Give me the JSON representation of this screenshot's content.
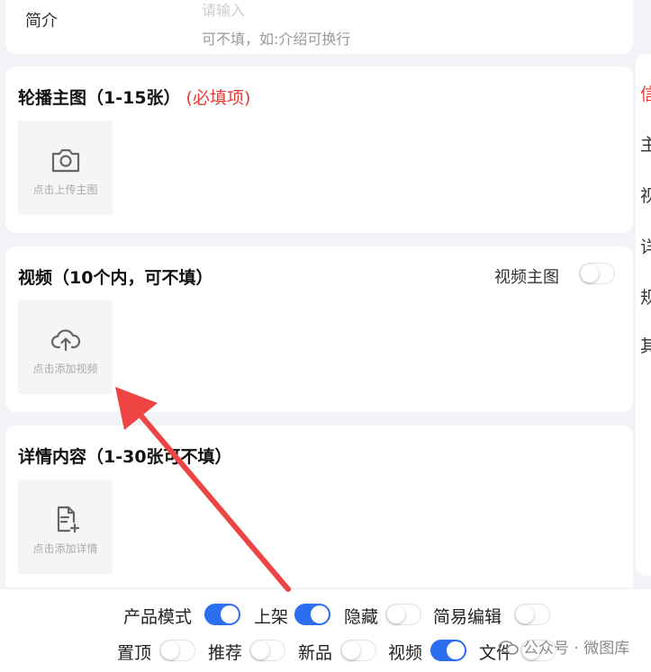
{
  "intro": {
    "label": "简介",
    "placeholder": "请输入",
    "hint": "可不填，如:介绍可换行"
  },
  "carousel": {
    "title": "轮播主图（1-15张）",
    "required": "(必填项)",
    "upload_label": "点击上传主图",
    "icon": "camera-icon"
  },
  "video": {
    "title": "视频（10个内，可不填）",
    "toggle_label": "视频主图",
    "toggle_on": false,
    "upload_label": "点击添加视频",
    "icon": "cloud-upload-icon"
  },
  "details": {
    "title": "详情内容（1-30张可不填）",
    "upload_label": "点击添加详情",
    "icon": "file-add-icon"
  },
  "right_panel": {
    "chars": [
      "信",
      "主",
      "视",
      "详",
      "规",
      "其"
    ],
    "accent": "#e53935"
  },
  "options_row1": [
    {
      "label": "产品模式",
      "on": true
    },
    {
      "label": "上架",
      "on": true
    },
    {
      "label": "隐藏",
      "on": false
    },
    {
      "label": "简易编辑",
      "on": false
    }
  ],
  "options_row2": [
    {
      "label": "置顶",
      "on": false
    },
    {
      "label": "推荐",
      "on": false
    },
    {
      "label": "新品",
      "on": false
    },
    {
      "label": "视频",
      "on": true
    },
    {
      "label": "文件",
      "on": false
    }
  ],
  "watermark": "公众号 · 微图库",
  "colors": {
    "switch_on": "#2b6ff0",
    "required": "#e53935",
    "arrow": "#ee4444"
  }
}
